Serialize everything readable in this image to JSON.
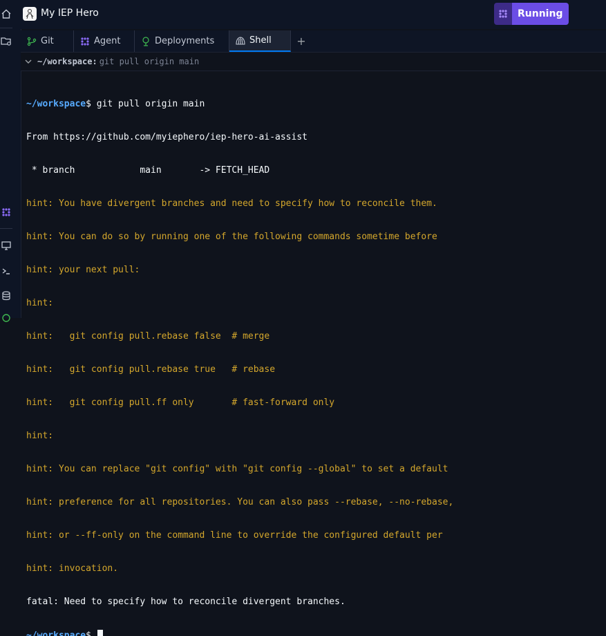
{
  "app": {
    "title": "My IEP Hero",
    "run_label": "Running"
  },
  "tabs": [
    {
      "label": "Git",
      "icon": "git-icon"
    },
    {
      "label": "Agent",
      "icon": "agent-icon"
    },
    {
      "label": "Deployments",
      "icon": "deployments-icon"
    },
    {
      "label": "Shell",
      "icon": "shell-icon",
      "active": true
    }
  ],
  "pathbar": {
    "path": "~/workspace:",
    "command": "git pull origin main"
  },
  "terminal": {
    "prompt": "~/workspace",
    "command": "$ git pull origin main",
    "output": [
      {
        "kind": "plain",
        "text": "From https://github.com/myiephero/iep-hero-ai-assist"
      },
      {
        "kind": "plain",
        "text": " * branch            main       -> FETCH_HEAD"
      },
      {
        "kind": "hint",
        "text": "hint: You have divergent branches and need to specify how to reconcile them."
      },
      {
        "kind": "hint",
        "text": "hint: You can do so by running one of the following commands sometime before"
      },
      {
        "kind": "hint",
        "text": "hint: your next pull:"
      },
      {
        "kind": "hint",
        "text": "hint:"
      },
      {
        "kind": "hint",
        "text": "hint:   git config pull.rebase false  # merge"
      },
      {
        "kind": "hint",
        "text": "hint:   git config pull.rebase true   # rebase"
      },
      {
        "kind": "hint",
        "text": "hint:   git config pull.ff only       # fast-forward only"
      },
      {
        "kind": "hint",
        "text": "hint:"
      },
      {
        "kind": "hint",
        "text": "hint: You can replace \"git config\" with \"git config --global\" to set a default"
      },
      {
        "kind": "hint",
        "text": "hint: preference for all repositories. You can also pass --rebase, --no-rebase,"
      },
      {
        "kind": "hint",
        "text": "hint: or --ff-only on the command line to override the configured default per"
      },
      {
        "kind": "hint",
        "text": "hint: invocation."
      },
      {
        "kind": "plain",
        "text": "fatal: Need to specify how to reconcile divergent branches."
      }
    ],
    "final_prompt": "~/workspace",
    "final_symbol": "$"
  },
  "colors": {
    "prompt": "#57abff",
    "hint": "#d4a72c",
    "accent": "#6b4de6"
  }
}
